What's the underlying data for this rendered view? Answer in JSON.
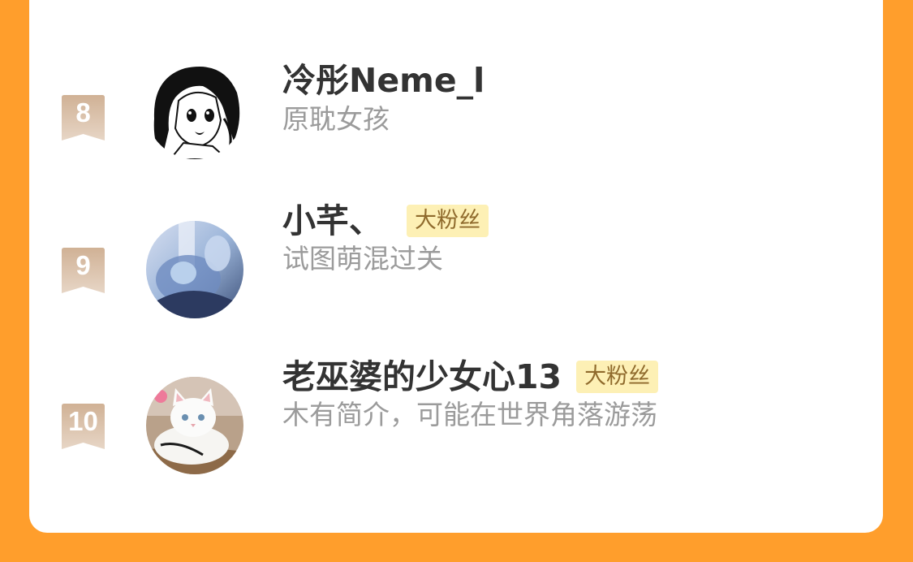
{
  "ranking": {
    "items": [
      {
        "rank": "8",
        "name": "冷彤Neme_l",
        "badge": null,
        "bio": "原耽女孩",
        "avatar_icon": "anime-girl-avatar-icon"
      },
      {
        "rank": "9",
        "name": "小芊、",
        "badge": "大粉丝",
        "bio": "试图萌混过关",
        "avatar_icon": "blue-anime-avatar-icon"
      },
      {
        "rank": "10",
        "name": "老巫婆的少女心13",
        "badge": "大粉丝",
        "bio": "木有简介，可能在世界角落游荡",
        "avatar_icon": "white-cat-avatar-icon"
      }
    ]
  },
  "colors": {
    "page_background": "#FF9E2C",
    "card_background": "#FFFFFF",
    "rank_badge": "#C9A98C",
    "name_text": "#333333",
    "bio_text": "#9B9B9B",
    "fan_badge_background": "#FDF0B5",
    "fan_badge_text": "#8F6A2C"
  }
}
